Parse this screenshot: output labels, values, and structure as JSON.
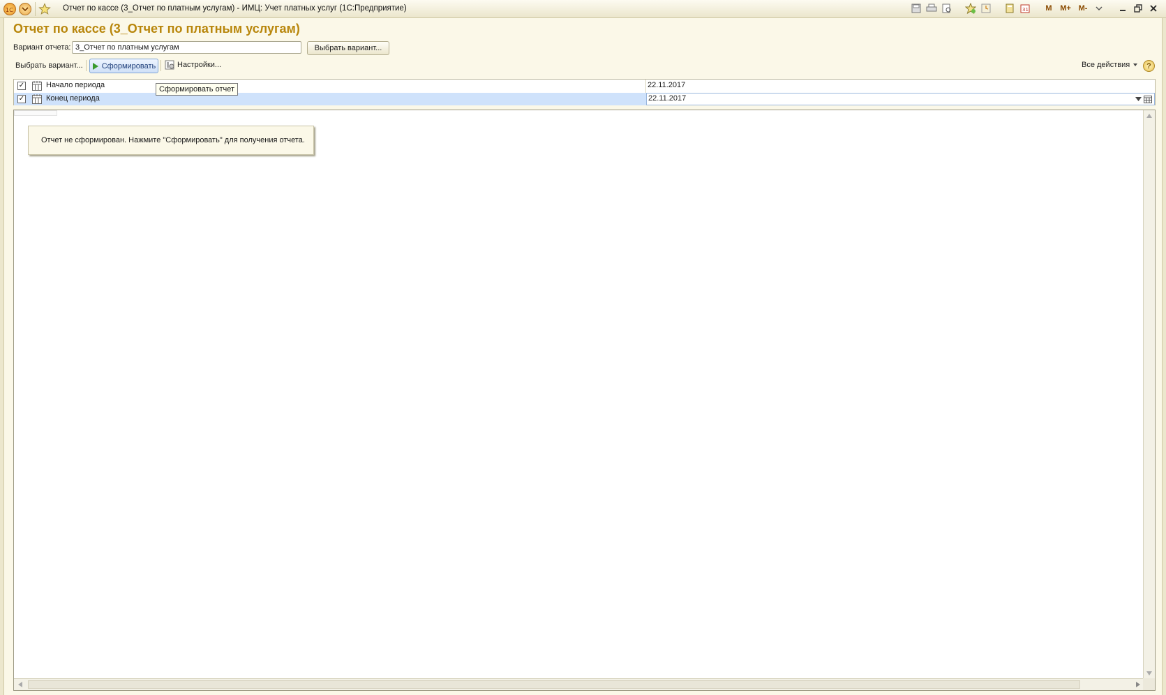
{
  "window": {
    "title": "Отчет по кассе (3_Отчет по платным услугам) - ИМЦ: Учет платных услуг  (1С:Предприятие)",
    "toolbar_icons": [
      "save-icon",
      "print-icon",
      "preview-icon",
      "add-favorite-icon",
      "history-icon",
      "calculator-icon",
      "calendar-icon"
    ],
    "m_label": "M",
    "mplus_label": "M+",
    "mminus_label": "M-"
  },
  "page": {
    "title": "Отчет по кассе (3_Отчет по платным услугам)"
  },
  "variant": {
    "label": "Вариант отчета:",
    "value": "3_Отчет по платным услугам",
    "choose_button": "Выбрать вариант..."
  },
  "commandbar": {
    "choose_variant": "Выбрать вариант...",
    "generate": "Сформировать",
    "settings": "Настройки...",
    "all_actions": "Все действия",
    "help": "?"
  },
  "tooltip": "Сформировать отчет",
  "settings_rows": [
    {
      "label": "Начало периода",
      "value": "22.11.2017",
      "checked": true
    },
    {
      "label": "Конец периода",
      "value": "22.11.2017",
      "checked": true
    }
  ],
  "report": {
    "message": "Отчет не сформирован. Нажмите \"Сформировать\" для получения отчета."
  },
  "colors": {
    "title": "#b8860b",
    "selected_row": "#cfe2fb",
    "background": "#fbf8e8"
  }
}
